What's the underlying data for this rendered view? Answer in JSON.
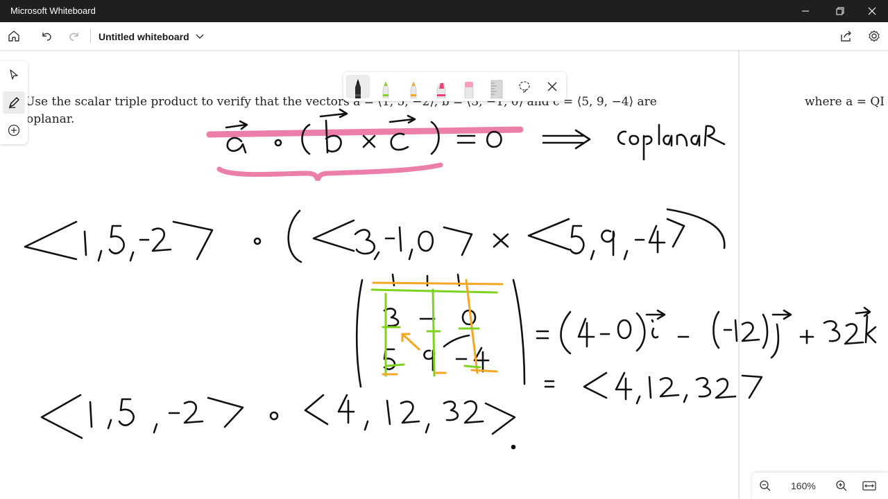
{
  "window": {
    "title": "Microsoft Whiteboard",
    "minimize_icon": "minimize-icon",
    "restore_icon": "restore-icon",
    "close_icon": "close-icon"
  },
  "appbar": {
    "home_icon": "home-icon",
    "undo_icon": "undo-icon",
    "redo_icon": "redo-icon",
    "board_title": "Untitled whiteboard",
    "share_icon": "share-icon",
    "settings_icon": "gear-icon"
  },
  "left_toolbar": {
    "items": [
      "select-tool",
      "inking-tool",
      "add-tool"
    ],
    "active": "inking-tool"
  },
  "pen_tray": {
    "tools": [
      "black-pen",
      "green-pen",
      "yellow-pen",
      "pink-highlighter",
      "eraser",
      "ruler",
      "lasso-select"
    ],
    "active": "black-pen",
    "colors": {
      "black": "#1a1a1a",
      "green": "#7ed321",
      "yellow": "#f5a623",
      "pink": "#e8407a"
    }
  },
  "document": {
    "line1": "Use the scalar triple product to verify that the vectors a = ⟨1, 5, −2⟩, b = ⟨3, −1, 0⟩ and c = ⟨5, 9, −4⟩ are",
    "line2": "oplanar.",
    "right_fragment": "where a = QI"
  },
  "ink": {
    "line1": "a · (b × c) = 0  ⟹  coplanar",
    "line2": "⟨1,5,−2⟩ · (⟨3,−1,0⟩ × ⟨5,9,−4⟩)",
    "determinant_result": "= (4−0)i − (−12)j + 32k",
    "vector_result": "= ⟨4, 12, 32⟩",
    "line4": "⟨1,5,−2⟩ · ⟨4, 12, 32⟩",
    "highlight_color": "#e8689a"
  },
  "zoom": {
    "level": "160%",
    "zoom_out_icon": "zoom-out-icon",
    "zoom_in_icon": "zoom-in-icon",
    "fit_icon": "fit-width-icon"
  }
}
